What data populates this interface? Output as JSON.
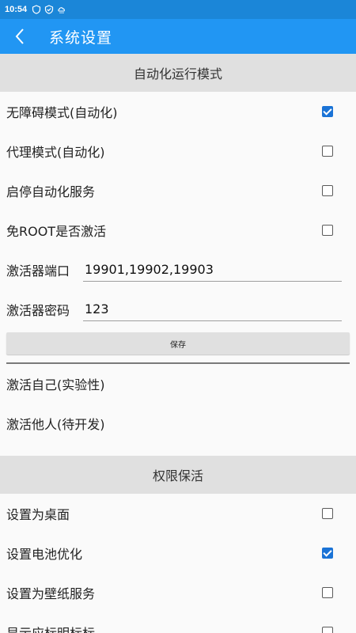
{
  "status": {
    "time": "10:54"
  },
  "header": {
    "title": "系统设置"
  },
  "sections": {
    "automation": {
      "title": "自动化运行模式",
      "accessibility_label": "无障碍模式(自动化)",
      "proxy_label": "代理模式(自动化)",
      "startstop_label": "启停自动化服务",
      "noroot_label": "免ROOT是否激活",
      "port_label": "激活器端口",
      "port_value": "19901,19902,19903",
      "password_label": "激活器密码",
      "password_value": "123",
      "save_label": "保存",
      "activate_self": "激活自己(实验性)",
      "activate_others": "激活他人(待开发)"
    },
    "keepalive": {
      "title": "权限保活",
      "desktop_label": "设置为桌面",
      "battery_label": "设置电池优化",
      "wallpaper_label": "设置为壁纸服务",
      "more_label": "显示应标明标标"
    }
  },
  "checkbox_states": {
    "accessibility": true,
    "proxy": false,
    "startstop": false,
    "noroot": false,
    "desktop": false,
    "battery": true,
    "wallpaper": false,
    "more": false
  },
  "colors": {
    "primary": "#2196f3",
    "status_bar": "#1b86d8",
    "checkbox_on": "#1a73d6"
  }
}
